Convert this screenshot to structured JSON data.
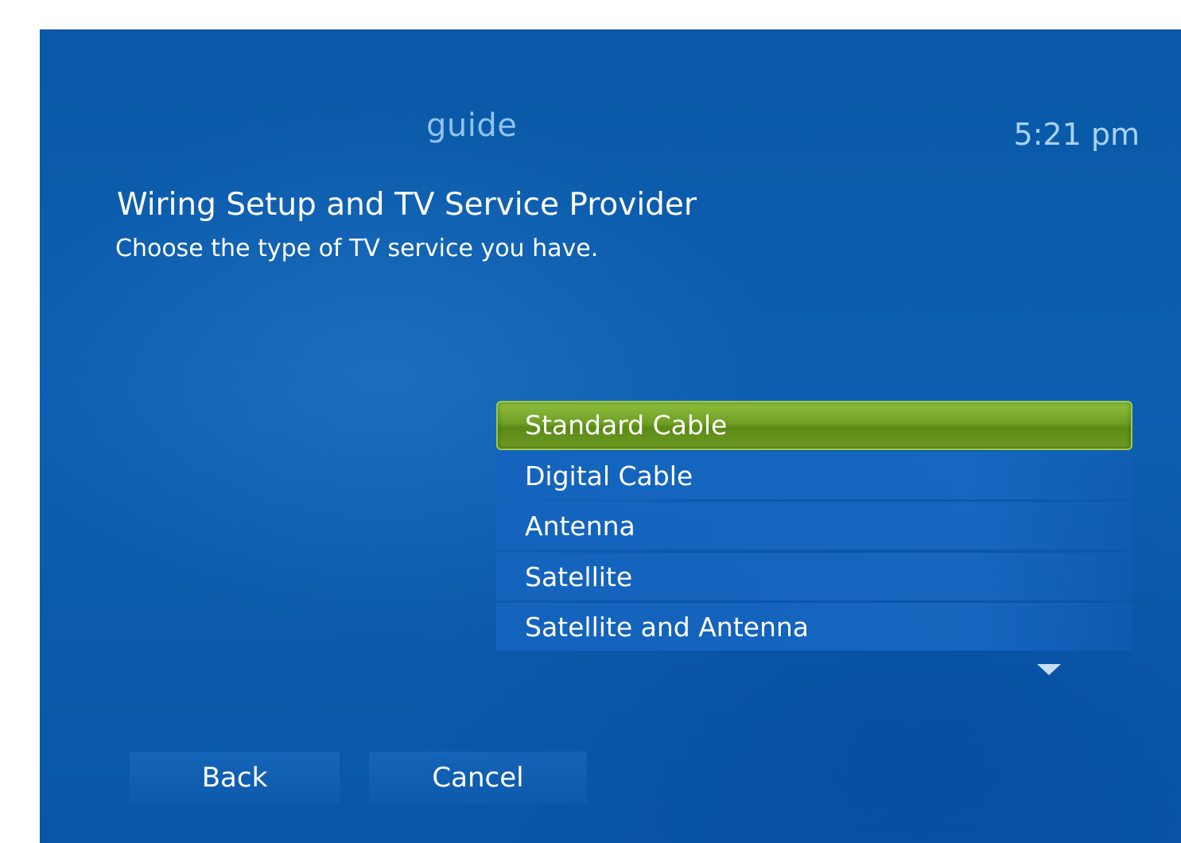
{
  "header": {
    "title": "guide",
    "clock": "5:21 pm"
  },
  "page": {
    "heading": "Wiring Setup and TV Service Provider",
    "subtitle": "Choose the type of TV service you have."
  },
  "options": {
    "selected_index": 0,
    "items": [
      {
        "label": "Standard Cable"
      },
      {
        "label": "Digital Cable"
      },
      {
        "label": "Antenna"
      },
      {
        "label": "Satellite"
      },
      {
        "label": "Satellite and Antenna"
      }
    ],
    "scroll_icon": "chevron-down-icon"
  },
  "navigation": {
    "back_label": "Back",
    "cancel_label": "Cancel"
  },
  "colors": {
    "background": "#0a58a8",
    "selected": "#6f9f24",
    "header_text": "#8fc3ee",
    "text": "#ffffff"
  }
}
